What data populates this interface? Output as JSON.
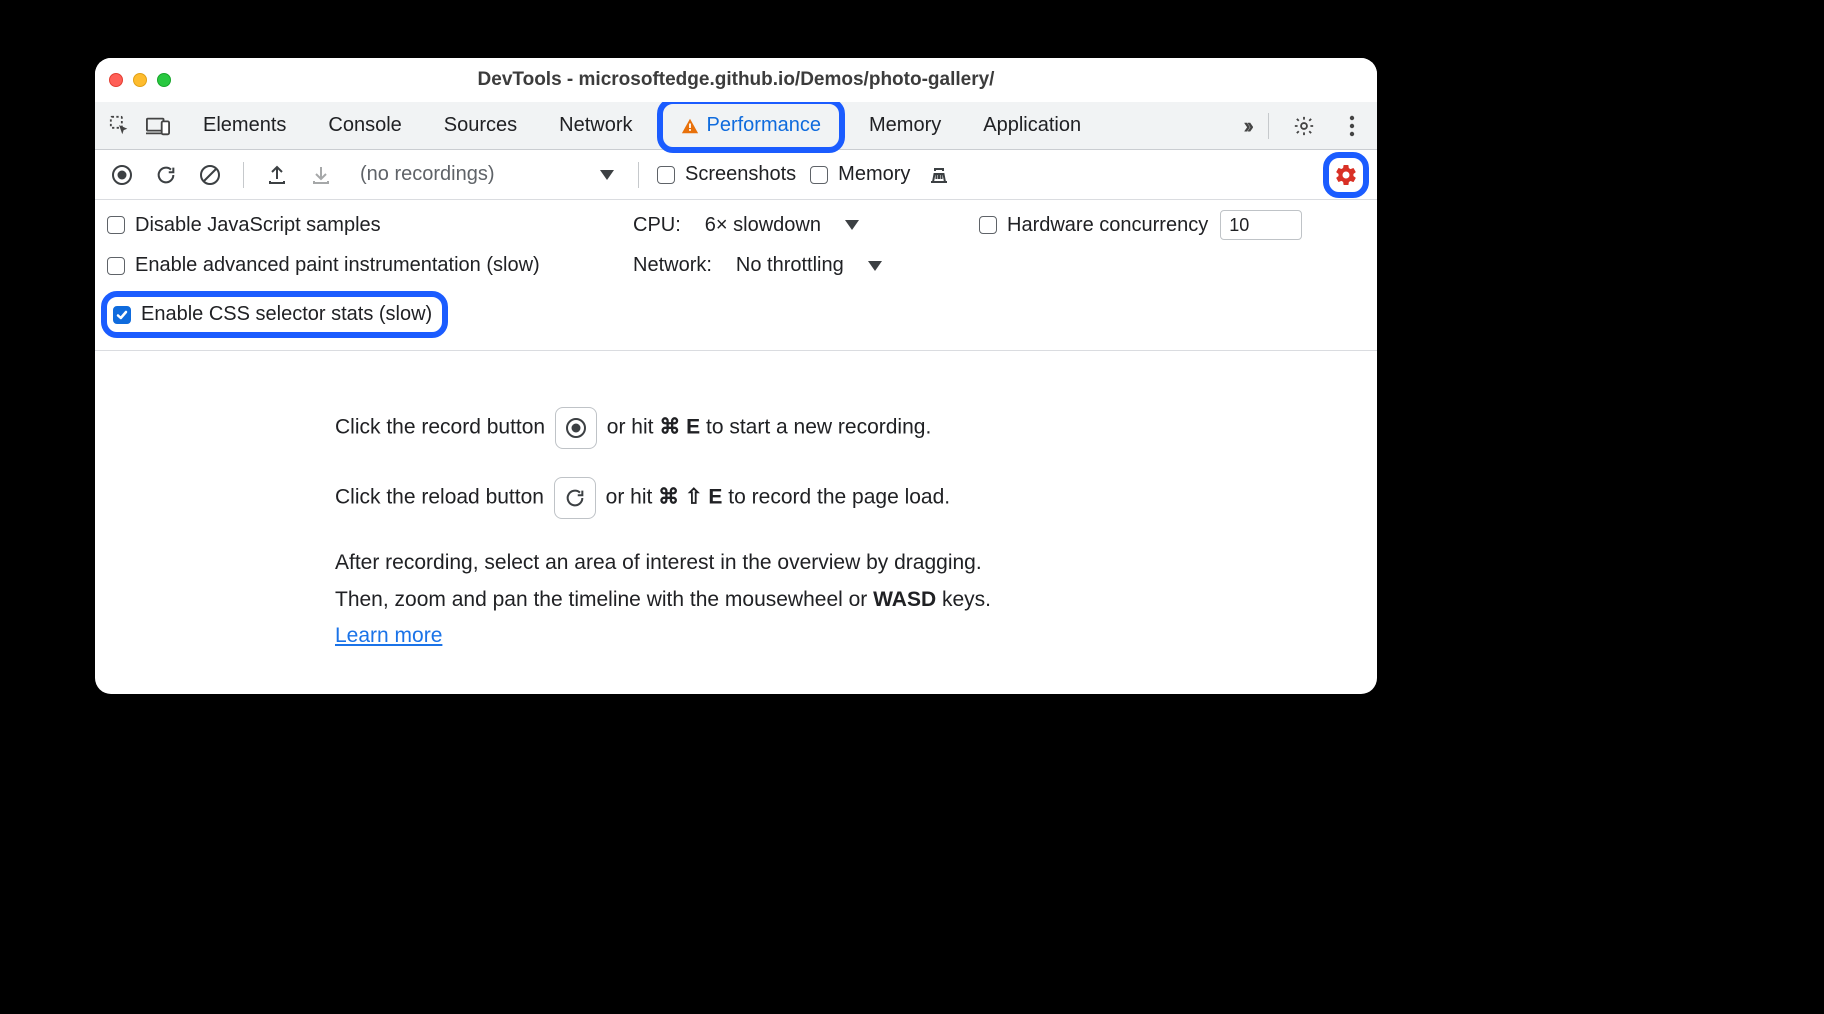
{
  "color_accent_blue": "#0f6bdd",
  "color_highlight_blue": "#1b5cff",
  "color_settings_red": "#d93025",
  "color_link": "#1a73e8",
  "window": {
    "title": "DevTools - microsoftedge.github.io/Demos/photo-gallery/"
  },
  "tabs": [
    {
      "id": "elements",
      "label": "Elements",
      "active": false
    },
    {
      "id": "console",
      "label": "Console",
      "active": false
    },
    {
      "id": "sources",
      "label": "Sources",
      "active": false
    },
    {
      "id": "network",
      "label": "Network",
      "active": false
    },
    {
      "id": "performance",
      "label": "Performance",
      "active": true,
      "warning": true
    },
    {
      "id": "memory",
      "label": "Memory",
      "active": false
    },
    {
      "id": "application",
      "label": "Application",
      "active": false
    }
  ],
  "toolbar": {
    "recordings_placeholder": "(no recordings)",
    "screenshots": {
      "label": "Screenshots",
      "checked": false
    },
    "memory": {
      "label": "Memory",
      "checked": false
    }
  },
  "settings": {
    "disable_js": {
      "label": "Disable JavaScript samples",
      "checked": false
    },
    "paint_instr": {
      "label": "Enable advanced paint instrumentation (slow)",
      "checked": false
    },
    "css_stats": {
      "label": "Enable CSS selector stats (slow)",
      "checked": true
    },
    "cpu": {
      "label": "CPU:",
      "value": "6× slowdown"
    },
    "network": {
      "label": "Network:",
      "value": "No throttling"
    },
    "hw_conc": {
      "label": "Hardware concurrency",
      "checked": false,
      "value": "10"
    }
  },
  "landing": {
    "l1_pre": "Click the record button ",
    "l1_post": " or hit ",
    "l1_sc": "⌘ E",
    "l1_tail": " to start a new recording.",
    "l2_pre": "Click the reload button ",
    "l2_post": " or hit ",
    "l2_sc": "⌘ ⇧ E",
    "l2_tail": " to record the page load.",
    "p1": "After recording, select an area of interest in the overview by dragging.",
    "p2_a": "Then, zoom and pan the timeline with the mousewheel or ",
    "p2_kbd": "WASD",
    "p2_b": " keys.",
    "learn_more": "Learn more"
  }
}
